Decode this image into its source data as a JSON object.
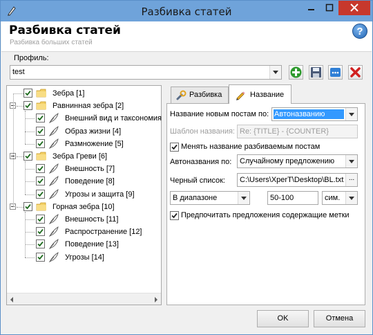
{
  "window": {
    "title": "Разбивка статей"
  },
  "header": {
    "title": "Разбивка статей",
    "subtitle": "Разбивка больших статей",
    "help_glyph": "?"
  },
  "profile": {
    "label": "Профиль:",
    "value": "test"
  },
  "toolbar": {
    "icons": [
      "add-icon",
      "save-icon",
      "more-icon",
      "delete-icon"
    ]
  },
  "tree": {
    "groups": [
      {
        "label": "Зебра [1]",
        "checked": true,
        "children": []
      },
      {
        "label": "Равнинная зебра [2]",
        "checked": true,
        "children": [
          {
            "label": "Внешний вид и таксономия"
          },
          {
            "label": "Образ жизни [4]"
          },
          {
            "label": "Размножение [5]"
          }
        ]
      },
      {
        "label": "Зебра Греви [6]",
        "checked": true,
        "children": [
          {
            "label": "Внешность [7]"
          },
          {
            "label": "Поведение [8]"
          },
          {
            "label": "Угрозы и защита [9]"
          }
        ]
      },
      {
        "label": "Горная зебра [10]",
        "checked": true,
        "children": [
          {
            "label": "Внешность [11]"
          },
          {
            "label": "Распространение [12]"
          },
          {
            "label": "Поведение [13]"
          },
          {
            "label": "Угрозы [14]"
          }
        ]
      }
    ]
  },
  "tabs": [
    {
      "label": "Разбивка",
      "active": false
    },
    {
      "label": "Название",
      "active": true
    }
  ],
  "form": {
    "new_posts_name_label": "Название новым постам по:",
    "new_posts_name_value": "Автоназванию",
    "template_label": "Шаблон названия:",
    "template_value": "Re: {TITLE} - {COUNTER}",
    "rename_checkbox_label": "Менять название разбиваемым постам",
    "rename_checked": true,
    "autoname_label": "Автоназвания по:",
    "autoname_value": "Случайному предложению",
    "blacklist_label": "Черный список:",
    "blacklist_value": "C:\\Users\\XperT\\Desktop\\BL.txt",
    "blacklist_button": "...",
    "range_mode": "В диапазоне",
    "range_value": "50-100",
    "range_unit": "сим.",
    "prefer_checkbox_label": "Предпочитать предложения содержащие метки",
    "prefer_checked": true
  },
  "buttons": {
    "ok": "OK",
    "cancel": "Отмена"
  },
  "colors": {
    "titlebar": "#6fa3da",
    "close": "#c7382c",
    "selection": "#3399ff",
    "add": "#2e9a2e",
    "delete": "#d02020"
  }
}
